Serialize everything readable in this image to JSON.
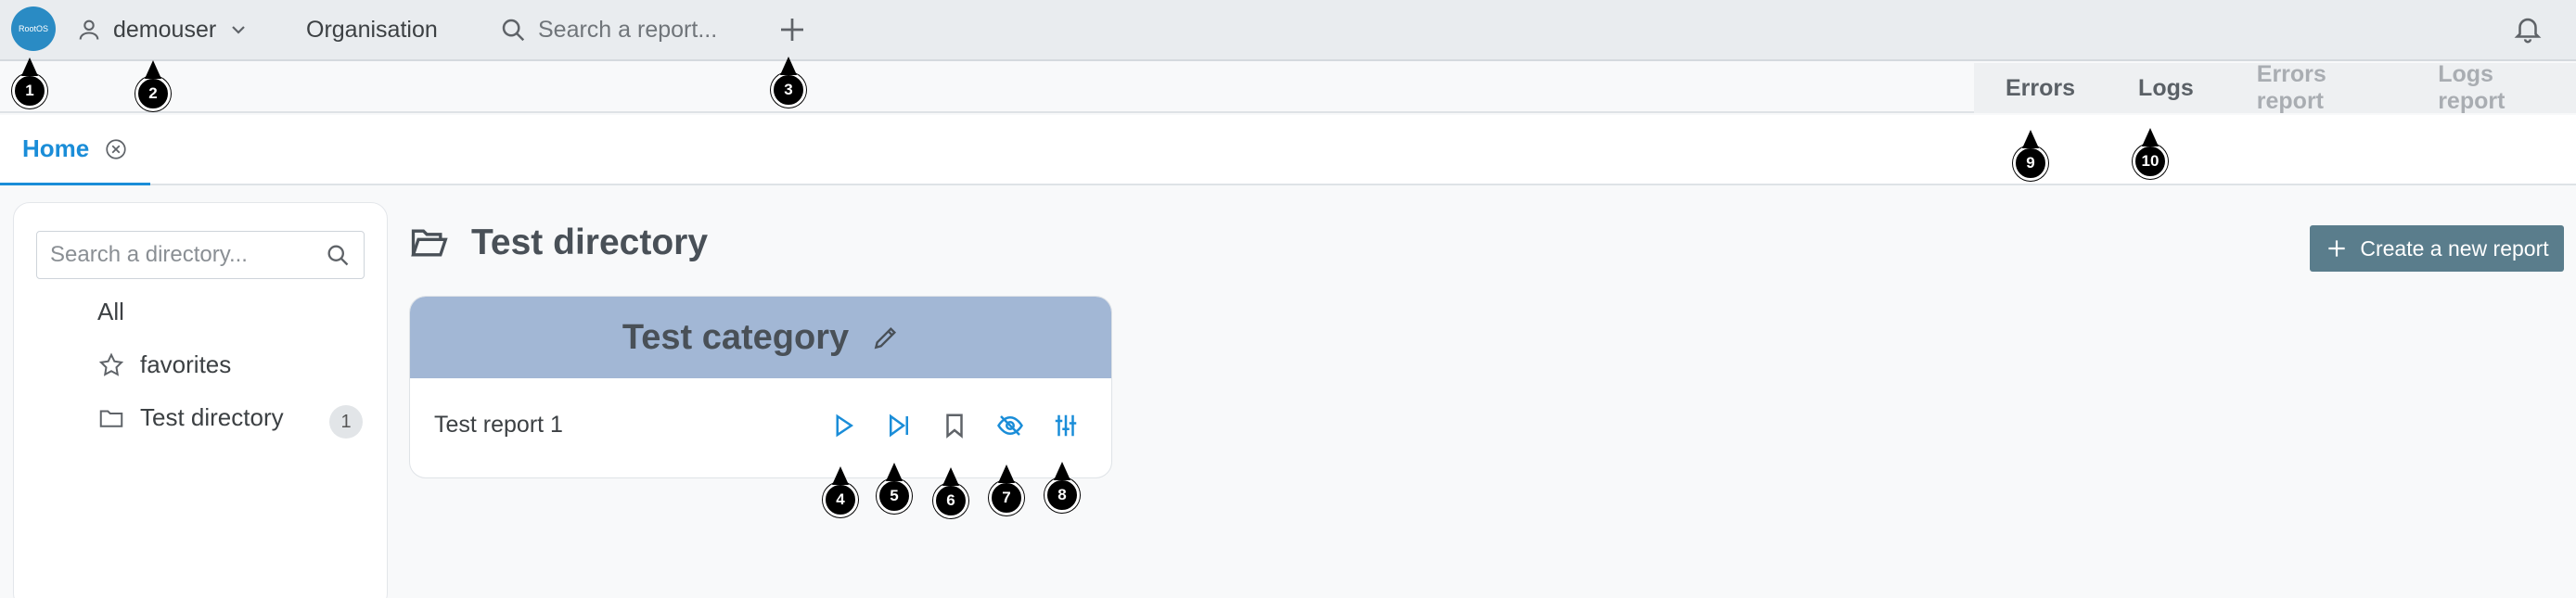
{
  "topbar": {
    "logo_text": "RootOS",
    "username": "demouser",
    "organisation": "Organisation",
    "search_placeholder": "Search a report...",
    "plus_icon": "plus-icon",
    "bell_icon": "bell-icon"
  },
  "subbar": {
    "links": [
      "Errors",
      "Logs",
      "Errors report",
      "Logs report"
    ]
  },
  "tabs": [
    {
      "label": "Home"
    }
  ],
  "sidebar": {
    "search_placeholder": "Search a directory...",
    "items": [
      {
        "label": "All"
      },
      {
        "label": "favorites"
      },
      {
        "label": "Test directory",
        "count": "1"
      }
    ]
  },
  "main": {
    "title": "Test directory",
    "create_button": "Create a new report",
    "category": {
      "title": "Test category",
      "reports": [
        {
          "name": "Test report 1"
        }
      ]
    }
  },
  "markers": [
    "1",
    "2",
    "3",
    "4",
    "5",
    "6",
    "7",
    "8",
    "9",
    "10"
  ],
  "colors": {
    "accent": "#1a8dd8",
    "category_header": "#a2b7d5",
    "create_button": "#5a7d8c"
  }
}
